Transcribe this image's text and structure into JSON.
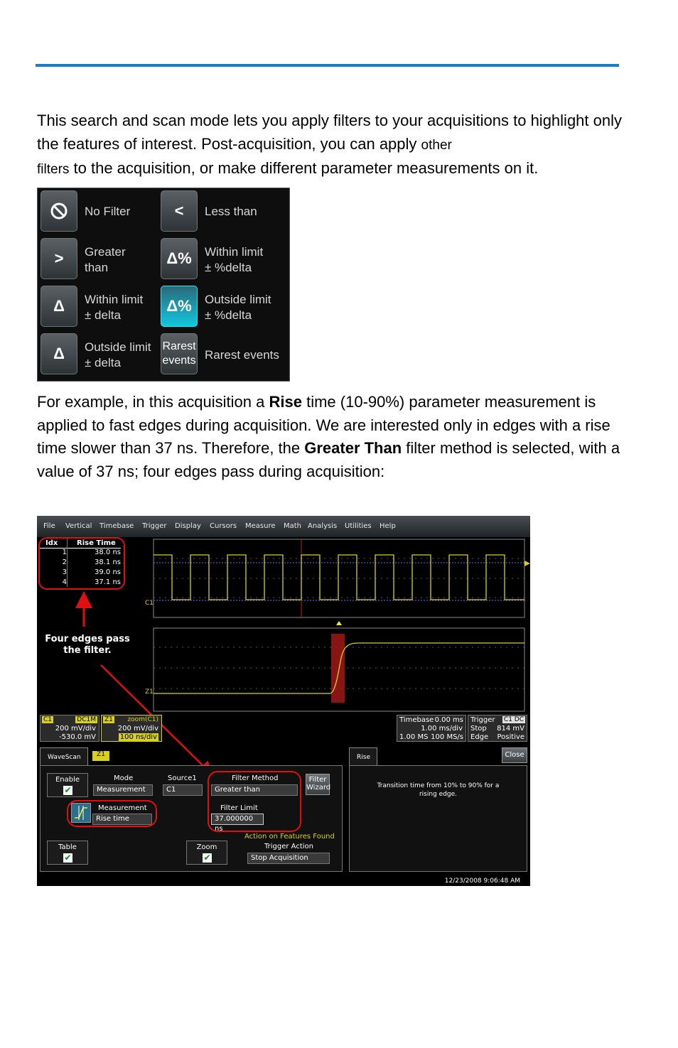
{
  "para1": {
    "pre": "This search and scan mode lets you apply filters to your acquisitions to highlight only the features of interest. Post-acquisition, you can apply ",
    "small1": "other",
    "small2": "filters",
    "post": " to the acquisition, or make different parameter measurements on it."
  },
  "filters": {
    "no_filter": {
      "icon": "⃠",
      "label": "No Filter"
    },
    "less_than": {
      "icon": "<",
      "label": "Less than"
    },
    "greater_than": {
      "icon": ">",
      "label1": "Greater",
      "label2": "than"
    },
    "within_pct": {
      "icon": "Δ%",
      "label1": "Within limit",
      "label2": "± %delta"
    },
    "within_delta": {
      "icon": "Δ",
      "label1": "Within limit",
      "label2": "± delta"
    },
    "outside_pct": {
      "icon": "Δ%",
      "label1": "Outside limit",
      "label2": "± %delta"
    },
    "outside_delta": {
      "icon": "Δ",
      "label1": "Outside limit",
      "label2": "± delta"
    },
    "rarest": {
      "btn1": "Rarest",
      "btn2": "events",
      "label": "Rarest events"
    }
  },
  "para2": {
    "a": "For example, in this acquisition a ",
    "b": "Rise",
    "c": " time (10-90%) parameter measurement is applied to fast edges during acquisition. We are interested only in edges with a rise time slower than 37 ns. Therefore, the ",
    "d": "Greater Than",
    "e": " filter method is selected, with a value of 37 ns; four edges pass during acquisition:"
  },
  "scope": {
    "menu": [
      "File",
      "Vertical",
      "Timebase",
      "Trigger",
      "Display",
      "Cursors",
      "Measure",
      "Math",
      "Analysis",
      "Utilities",
      "Help"
    ],
    "table": {
      "col_idx": "Idx",
      "col_rise": "Rise Time",
      "rows": [
        {
          "idx": "1",
          "val": "38.0 ns"
        },
        {
          "idx": "2",
          "val": "38.1 ns"
        },
        {
          "idx": "3",
          "val": "39.0 ns"
        },
        {
          "idx": "4",
          "val": "37.1 ns"
        }
      ]
    },
    "annotation": "Four edges pass the filter.",
    "trace_c1": "C1",
    "trace_z1": "Z1",
    "c1_box": {
      "tag": "C1",
      "coupling": "DC1M",
      "l1": "200 mV/div",
      "l2": "-530.0 mV"
    },
    "z1_box": {
      "tag": "Z1",
      "title": "zoom(C1)",
      "l1": "200 mV/div",
      "l2": "100 ns/div"
    },
    "timebase_box": {
      "title": "Timebase",
      "delay": "0.00 ms",
      "l1": "1.00 ms/div",
      "l2a": "1.00 MS",
      "l2b": "100 MS/s"
    },
    "trigger_box": {
      "title": "Trigger",
      "tag": "C1 DC",
      "l1a": "Stop",
      "l1b": "814 mV",
      "l2a": "Edge",
      "l2b": "Positive"
    },
    "wavescan": {
      "tab": "WaveScan",
      "tab2": "Z1",
      "enable": "Enable",
      "mode_label": "Mode",
      "mode_value": "Measurement",
      "source_label": "Source1",
      "source_value": "C1",
      "filter_method_label": "Filter Method",
      "filter_method_value": "Greater than",
      "filter_wizard1": "Filter",
      "filter_wizard2": "Wizard",
      "measurement_label": "Measurement",
      "measurement_value": "Rise time",
      "filter_limit_label": "Filter Limit",
      "filter_limit_value": "37.000000 ns",
      "table": "Table",
      "zoom": "Zoom",
      "action_label": "Action on Features Found",
      "trigger_action_label": "Trigger Action",
      "trigger_action_value": "Stop Acquisition"
    },
    "rise_panel": {
      "tab": "Rise",
      "close": "Close",
      "desc1": "Transition time from 10% to 90% for a",
      "desc2": "rising edge."
    },
    "timestamp": "12/23/2008 9:06:48 AM",
    "colors": {
      "trace": "#d8d020",
      "highlight": "#c01a1a",
      "annotation": "#e01010"
    }
  }
}
